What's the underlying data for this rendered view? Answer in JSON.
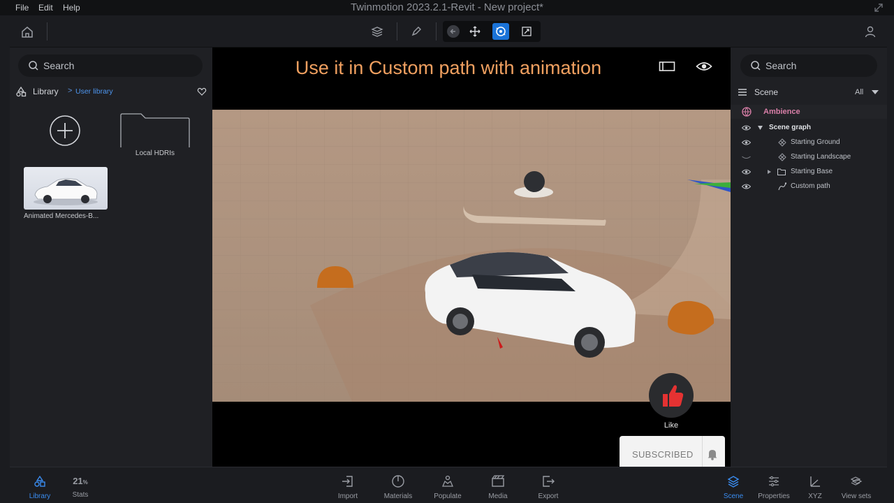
{
  "menubar": {
    "items": [
      "File",
      "Edit",
      "Help"
    ],
    "title": "Twinmotion 2023.2.1-Revit - New project*"
  },
  "toolbar": {
    "icons": [
      "home-icon",
      "layers-icon",
      "pen-icon",
      "back-icon",
      "move-icon",
      "orbit-icon",
      "scale-icon",
      "user-icon"
    ],
    "active_tool": "orbit-icon"
  },
  "left_panel": {
    "search_placeholder": "Search",
    "library_label": "Library",
    "breadcrumb_sep": ">",
    "current_library": "User library",
    "folder_label": "Local HDRIs",
    "asset_label": "Animated Mercedes-B..."
  },
  "viewport": {
    "caption": "Use it in Custom path with animation",
    "like_label": "Like",
    "subscribed_label": "SUBSCRIBED"
  },
  "right_panel": {
    "search_placeholder": "Search",
    "scene_label": "Scene",
    "filter_label": "All",
    "ambience_label": "Ambience",
    "tree": [
      {
        "label": "Scene graph"
      },
      {
        "label": "Starting Ground"
      },
      {
        "label": "Starting Landscape"
      },
      {
        "label": "Starting Base"
      },
      {
        "label": "Custom path"
      }
    ]
  },
  "bottombar": {
    "left": [
      {
        "label": "Library",
        "icon": "library-icon",
        "active": true
      },
      {
        "label": "Stats",
        "value": "21",
        "unit": "%"
      }
    ],
    "center": [
      {
        "label": "Import",
        "icon": "import-icon"
      },
      {
        "label": "Materials",
        "icon": "materials-icon"
      },
      {
        "label": "Populate",
        "icon": "populate-icon"
      },
      {
        "label": "Media",
        "icon": "media-icon"
      },
      {
        "label": "Export",
        "icon": "export-icon"
      }
    ],
    "right": [
      {
        "label": "Scene",
        "icon": "scene-icon",
        "active": true
      },
      {
        "label": "Properties",
        "icon": "properties-icon"
      },
      {
        "label": "XYZ",
        "icon": "xyz-icon"
      },
      {
        "label": "View sets",
        "icon": "view-sets-icon"
      }
    ]
  },
  "colors": {
    "accent": "#1a73d8",
    "caption": "#f0a060",
    "ambience": "#d97fa8",
    "panel": "#1f2024"
  }
}
